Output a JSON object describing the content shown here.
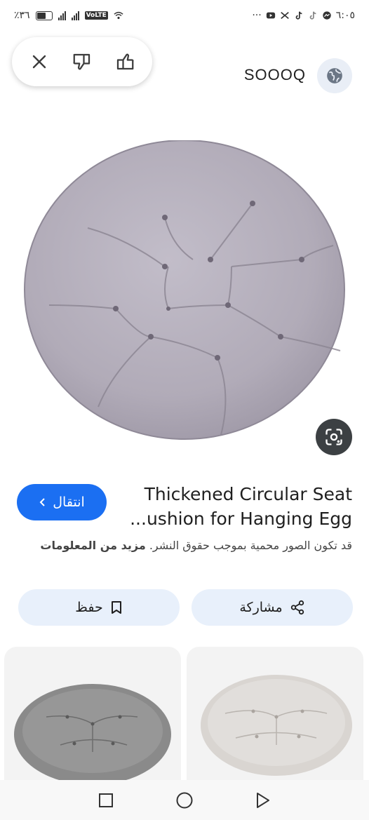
{
  "status": {
    "battery_percent": "٪٣٦",
    "time": "٦:٠٥"
  },
  "source": {
    "name": "SOOOQ"
  },
  "product": {
    "title_line1": "Thickened Circular Seat",
    "title_line2": "...ushion for Hanging Egg",
    "visit_label": "انتقال"
  },
  "notice": {
    "text": "قد تكون الصور محمية بموجب حقوق النشر.",
    "more_label": "مزيد من المعلومات"
  },
  "actions": {
    "share_label": "مشاركة",
    "save_label": "حفظ"
  },
  "colors": {
    "accent": "#1b6ff2",
    "action_bg": "#e8f0fb",
    "cushion_main": "#b3aebb",
    "thumb_gray": "#8a8a8a",
    "thumb_light": "#dcd8d4"
  },
  "icons": [
    "close-icon",
    "thumb-down-icon",
    "thumb-up-icon",
    "globe-icon",
    "lens-icon",
    "share-icon",
    "bookmark-icon",
    "chevron-left-icon"
  ]
}
